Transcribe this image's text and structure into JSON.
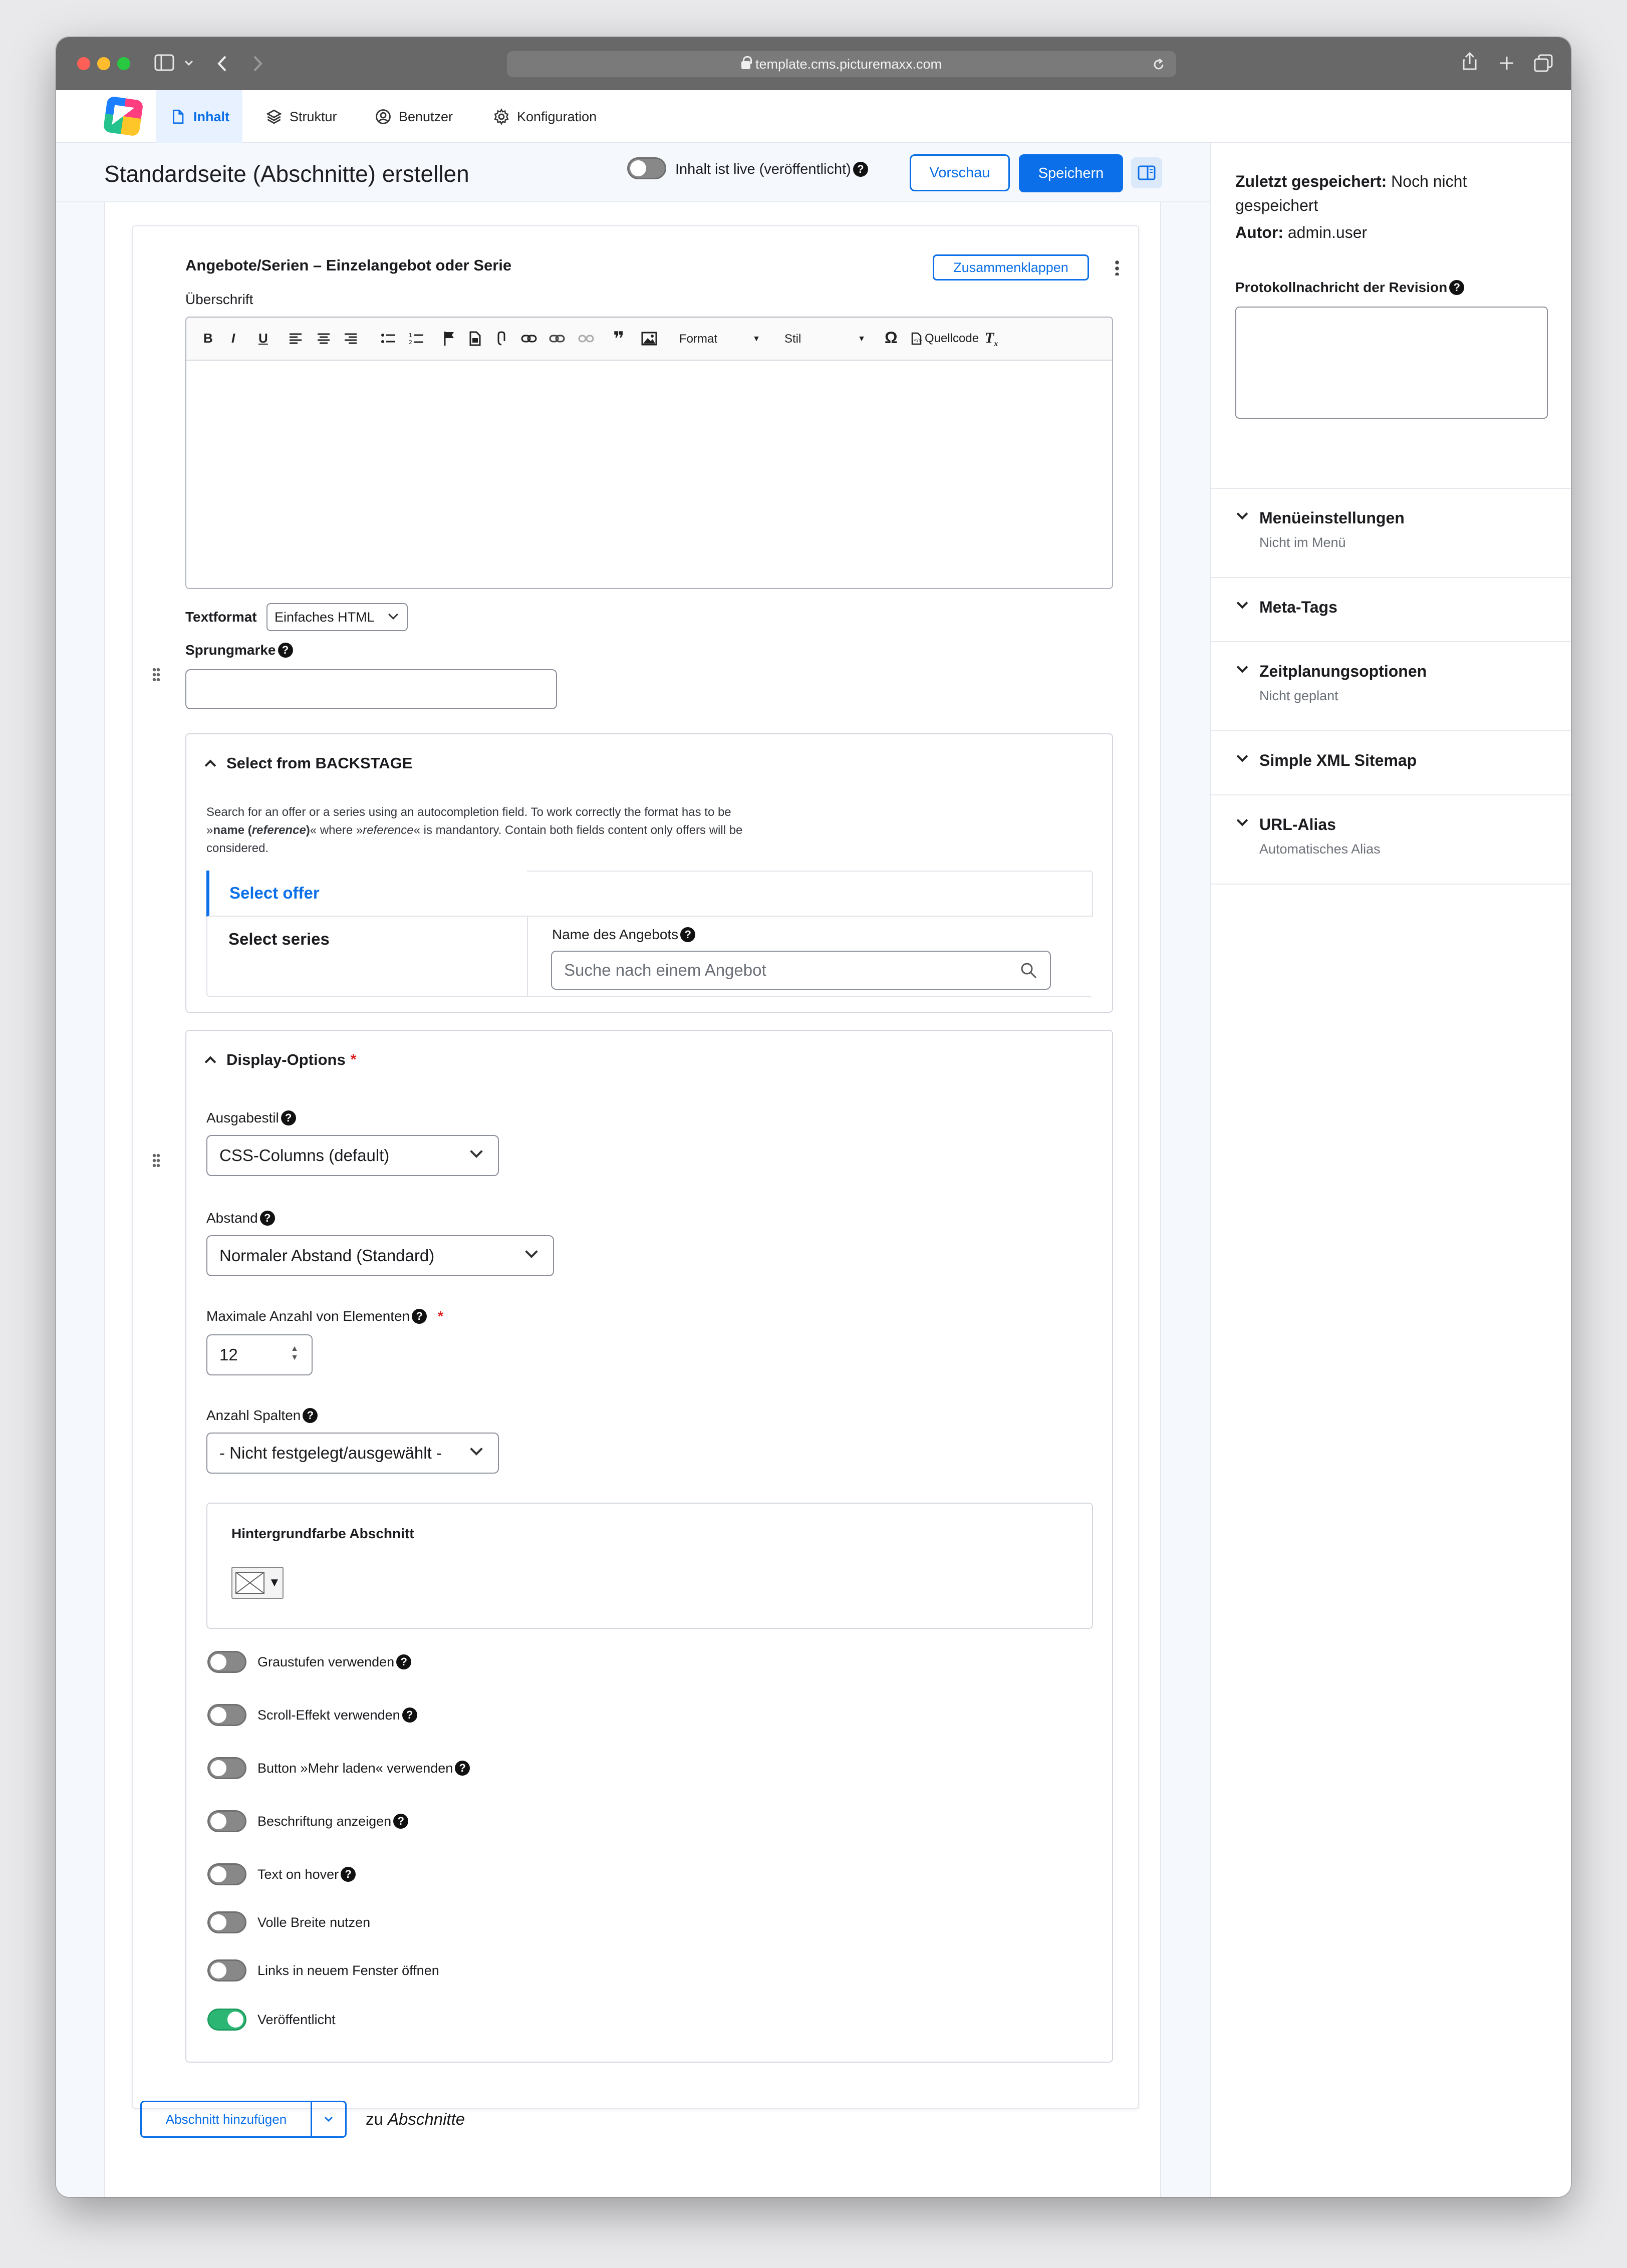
{
  "browser": {
    "url": "template.cms.picturemaxx.com"
  },
  "nav": {
    "tabs": [
      {
        "label": "Inhalt"
      },
      {
        "label": "Struktur"
      },
      {
        "label": "Benutzer"
      },
      {
        "label": "Konfiguration"
      }
    ]
  },
  "header": {
    "title": "Standardseite (Abschnitte) erstellen",
    "live_label": "Inhalt ist live (veröffentlicht)",
    "live_on": false,
    "preview_label": "Vorschau",
    "save_label": "Speichern"
  },
  "section": {
    "title": "Angebote/Serien – Einzelangebot oder Serie",
    "collapse_label": "Zusammenklappen",
    "heading_label": "Überschrift",
    "toolbar": {
      "format": "Format",
      "style": "Stil",
      "source": "Quellcode"
    },
    "textformat_label": "Textformat",
    "textformat_value": "Einfaches HTML",
    "anchor_label": "Sprungmarke",
    "anchor_value": ""
  },
  "backstage": {
    "title": "Select from BACKSTAGE",
    "description_line1": "Search for an offer or a series using an autocompletion field. To work correctly the format has to be",
    "description_line2_a": "»",
    "description_line2_b": "name (",
    "description_line2_c": "reference",
    "description_line2_d": ")",
    "description_line2_e": "« where »",
    "description_line2_f": "reference",
    "description_line2_g": "« is mandantory. Contain both fields content only offers will be",
    "description_line3": "considered.",
    "tabs": [
      {
        "label": "Select offer"
      },
      {
        "label": "Select series"
      }
    ],
    "field_label": "Name des Angebots",
    "field_placeholder": "Suche nach einem Angebot"
  },
  "display": {
    "title": "Display-Options",
    "required_mark": "*",
    "ausgabestil_label": "Ausgabestil",
    "ausgabestil_value": "CSS-Columns (default)",
    "abstand_label": "Abstand",
    "abstand_value": "Normaler Abstand (Standard)",
    "max_label": "Maximale Anzahl von Elementen",
    "max_value": "12",
    "spalten_label": "Anzahl Spalten",
    "spalten_value": "- Nicht festgelegt/ausgewählt -",
    "bg_label": "Hintergrundfarbe Abschnitt",
    "switches": [
      {
        "label": "Graustufen verwenden",
        "on": false,
        "help": true
      },
      {
        "label": "Scroll-Effekt verwenden",
        "on": false,
        "help": true
      },
      {
        "label": "Button »Mehr laden« verwenden",
        "on": false,
        "help": true
      },
      {
        "label": "Beschriftung anzeigen",
        "on": false,
        "help": true
      },
      {
        "label": "Text on hover",
        "on": false,
        "help": true
      },
      {
        "label": "Volle Breite nutzen",
        "on": false,
        "help": false
      },
      {
        "label": "Links in neuem Fenster öffnen",
        "on": false,
        "help": false
      },
      {
        "label": "Veröffentlicht",
        "on": true,
        "help": false
      }
    ]
  },
  "footer": {
    "add_label": "Abschnitt hinzufügen",
    "zu": "zu",
    "target": "Abschnitte"
  },
  "sidebar": {
    "saved_label": "Zuletzt gespeichert:",
    "saved_value_line1": "Noch nicht",
    "saved_value_line2": "gespeichert",
    "author_label": "Autor:",
    "author_value": "admin.user",
    "revision_label": "Protokollnachricht der Revision",
    "sections": [
      {
        "title": "Menüeinstellungen",
        "subtitle": "Nicht im Menü"
      },
      {
        "title": "Meta-Tags",
        "subtitle": ""
      },
      {
        "title": "Zeitplanungsoptionen",
        "subtitle": "Nicht geplant"
      },
      {
        "title": "Simple XML Sitemap",
        "subtitle": ""
      },
      {
        "title": "URL-Alias",
        "subtitle": "Automatisches Alias"
      }
    ]
  },
  "colors": {
    "accent": "#0a6fe8",
    "toggle_on": "#2bb673",
    "toggle_off": "#888888",
    "required": "#e02020"
  }
}
